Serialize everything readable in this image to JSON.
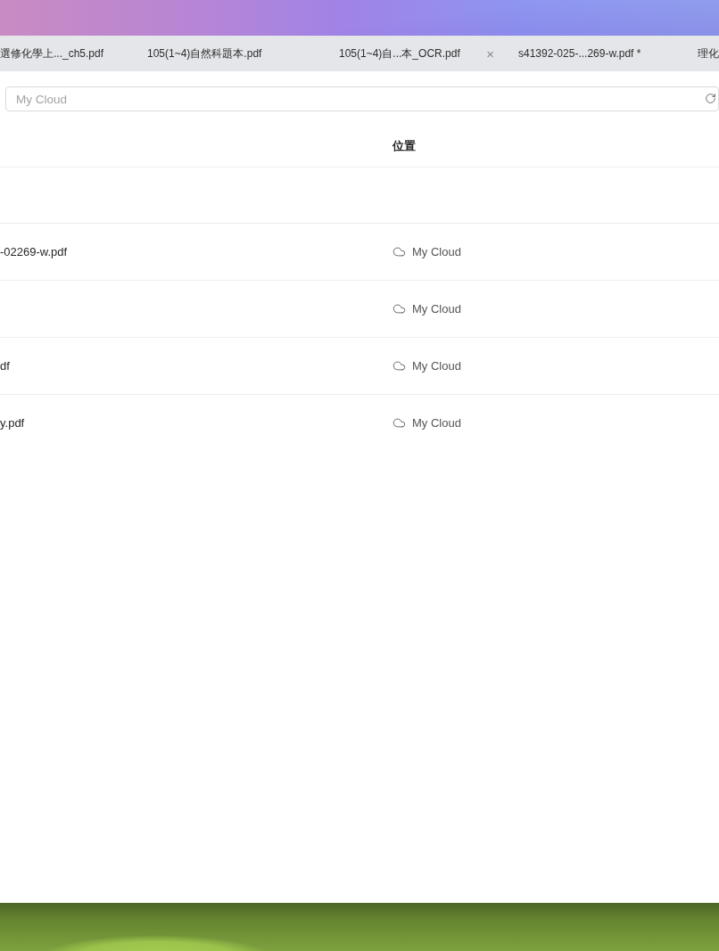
{
  "tabs": [
    {
      "label": "選修化學上..._ch5.pdf"
    },
    {
      "label": "105(1~4)自然科題本.pdf"
    },
    {
      "label": "105(1~4)自...本_OCR.pdf",
      "close": "×"
    },
    {
      "label": "s41392-025-...269-w.pdf *"
    },
    {
      "label": "理化"
    }
  ],
  "location_field": {
    "placeholder": "My Cloud"
  },
  "table": {
    "header": {
      "location": "位置"
    },
    "rows": [
      {
        "name": "-02269-w.pdf",
        "location": "My Cloud"
      },
      {
        "location": "My Cloud"
      },
      {
        "name": "df",
        "location": "My Cloud"
      },
      {
        "name": "y.pdf",
        "location": "My Cloud"
      }
    ]
  }
}
